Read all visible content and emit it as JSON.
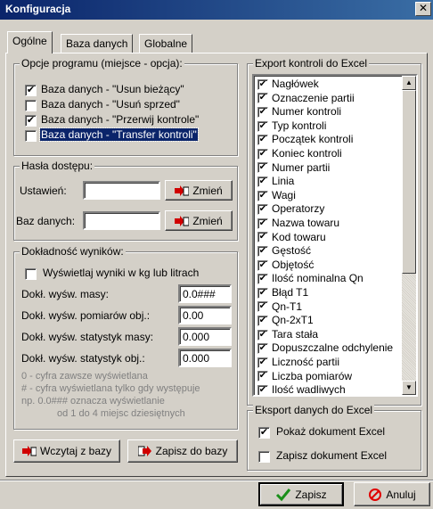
{
  "window": {
    "title": "Konfiguracja",
    "close_glyph": "✕"
  },
  "tabs": [
    {
      "label": "Ogólne"
    },
    {
      "label": "Baza danych"
    },
    {
      "label": "Globalne"
    }
  ],
  "options": {
    "legend": "Opcje programu (miejsce - opcja):",
    "items": [
      {
        "label": "Baza danych - \"Usun bieżący\"",
        "checked": true
      },
      {
        "label": "Baza danych - \"Usuń sprzed\"",
        "checked": false
      },
      {
        "label": "Baza danych - \"Przerwij kontrole\"",
        "checked": true
      },
      {
        "label": "Baza danych - \"Transfer kontroli\"",
        "checked": false
      }
    ]
  },
  "passwords": {
    "legend": "Hasła dostępu:",
    "settings_label": "Ustawień:",
    "settings_value": "",
    "db_label": "Baz danych:",
    "db_value": "",
    "change_label": "Zmień"
  },
  "precision": {
    "legend": "Dokładność wyników:",
    "kg_label": "Wyświetlaj wyniki w kg lub litrach",
    "kg_checked": false,
    "rows": [
      {
        "label": "Dokł. wyśw. masy:",
        "value": "0.0###"
      },
      {
        "label": "Dokł. wyśw. pomiarów obj.:",
        "value": "0.00"
      },
      {
        "label": "Dokł. wyśw. statystyk masy:",
        "value": "0.000"
      },
      {
        "label": "Dokł. wyśw. statystyk obj.:",
        "value": "0.000"
      }
    ],
    "notes": [
      "0 - cyfra zawsze wyświetlana",
      "# - cyfra wyświetlana tylko gdy występuje",
      "np. 0.0### oznacza wyświetlanie",
      "od 1 do 4 miejsc dziesiętnych"
    ]
  },
  "buttons": {
    "load": "Wczytaj z bazy",
    "save": "Zapisz do bazy",
    "ok": "Zapisz",
    "cancel": "Anuluj"
  },
  "export": {
    "legend": "Export kontroli do Excel",
    "items": [
      {
        "label": "Nagłówek",
        "checked": true
      },
      {
        "label": "Oznaczenie partii",
        "checked": true
      },
      {
        "label": "Numer kontroli",
        "checked": true
      },
      {
        "label": "Typ kontroli",
        "checked": true
      },
      {
        "label": "Początek kontroli",
        "checked": true
      },
      {
        "label": "Koniec kontroli",
        "checked": true
      },
      {
        "label": "Numer partii",
        "checked": true
      },
      {
        "label": "Linia",
        "checked": true
      },
      {
        "label": "Wagi",
        "checked": true
      },
      {
        "label": "Operatorzy",
        "checked": true
      },
      {
        "label": "Nazwa towaru",
        "checked": true
      },
      {
        "label": "Kod towaru",
        "checked": true
      },
      {
        "label": "Gęstość",
        "checked": true
      },
      {
        "label": "Objętość",
        "checked": true
      },
      {
        "label": "Ilość nominalna Qn",
        "checked": true
      },
      {
        "label": "Błąd T1",
        "checked": true
      },
      {
        "label": "Qn-T1",
        "checked": true
      },
      {
        "label": "Qn-2xT1",
        "checked": true
      },
      {
        "label": "Tara stała",
        "checked": true
      },
      {
        "label": "Dopuszczalne odchylenie",
        "checked": true
      },
      {
        "label": "Liczność partii",
        "checked": true
      },
      {
        "label": "Liczba pomiarów",
        "checked": true
      },
      {
        "label": "Ilość wadliwych",
        "checked": true
      }
    ]
  },
  "excel_export": {
    "legend": "Eksport danych do Excel",
    "show_label": "Pokaż dokument Excel",
    "show_checked": true,
    "save_label": "Zapisz dokument Excel",
    "save_checked": false
  },
  "colors": {
    "titlebar": "#0a246a",
    "face": "#d4d0c8",
    "selection": "#0a246a"
  }
}
